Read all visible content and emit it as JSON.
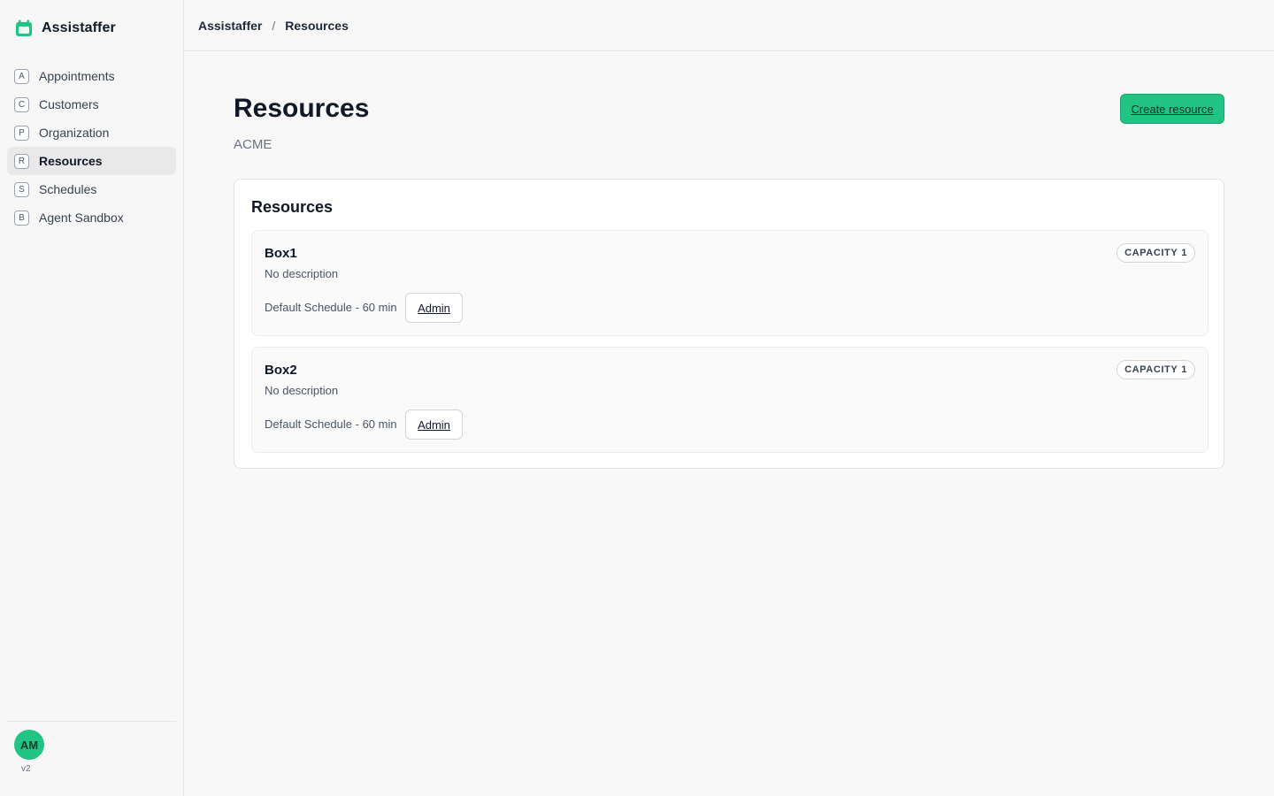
{
  "app": {
    "name": "Assistaffer",
    "version": "v2",
    "brand_color": "#20c483"
  },
  "sidebar": {
    "items": [
      {
        "key": "A",
        "label": "Appointments",
        "active": false
      },
      {
        "key": "C",
        "label": "Customers",
        "active": false
      },
      {
        "key": "P",
        "label": "Organization",
        "active": false
      },
      {
        "key": "R",
        "label": "Resources",
        "active": true
      },
      {
        "key": "S",
        "label": "Schedules",
        "active": false
      },
      {
        "key": "B",
        "label": "Agent Sandbox",
        "active": false
      }
    ],
    "user_initials": "AM"
  },
  "breadcrumb": {
    "root": "Assistaffer",
    "separator": "/",
    "current": "Resources"
  },
  "page": {
    "title": "Resources",
    "subtitle": "ACME",
    "create_button": "Create resource"
  },
  "panel": {
    "title": "Resources",
    "resources": [
      {
        "name": "Box1",
        "description": "No description",
        "schedule": "Default Schedule - 60 min",
        "admin_label": "Admin",
        "capacity_label": "CAPACITY",
        "capacity_value": "1"
      },
      {
        "name": "Box2",
        "description": "No description",
        "schedule": "Default Schedule - 60 min",
        "admin_label": "Admin",
        "capacity_label": "CAPACITY",
        "capacity_value": "1"
      }
    ]
  }
}
